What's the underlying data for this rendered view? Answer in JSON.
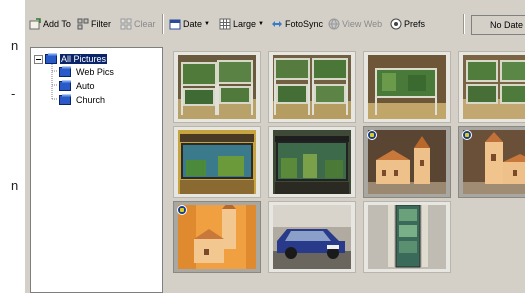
{
  "left_strip": {
    "chars": [
      "n",
      "-",
      "n"
    ]
  },
  "toolbar": {
    "add_to": "Add To",
    "filter": "Filter",
    "clear": "Clear",
    "date": "Date",
    "size": "Large",
    "fotosync": "FotoSync",
    "view_web": "View Web",
    "prefs": "Prefs",
    "status_text": "No Date"
  },
  "tree": {
    "root": "All Pictures",
    "children": [
      "Web Pics",
      "Auto",
      "Church"
    ]
  },
  "thumbnails": [
    {
      "subject": "aquarium-stands"
    },
    {
      "subject": "aquarium-stands"
    },
    {
      "subject": "aquarium-stands"
    },
    {
      "subject": "aquarium-stands"
    },
    {
      "subject": "aquarium-tank"
    },
    {
      "subject": "aquarium-tank"
    },
    {
      "subject": "church-model",
      "badge": true,
      "selected": true
    },
    {
      "subject": "church-model",
      "badge": true,
      "selected": true
    },
    {
      "subject": "church-model",
      "badge": true,
      "selected": true
    },
    {
      "subject": "blue-car"
    },
    {
      "subject": "display-cabinet"
    }
  ],
  "colors": {
    "selection": "#0a246a",
    "window": "#d4d0c8",
    "selected_cell": "#a9a7a1"
  }
}
